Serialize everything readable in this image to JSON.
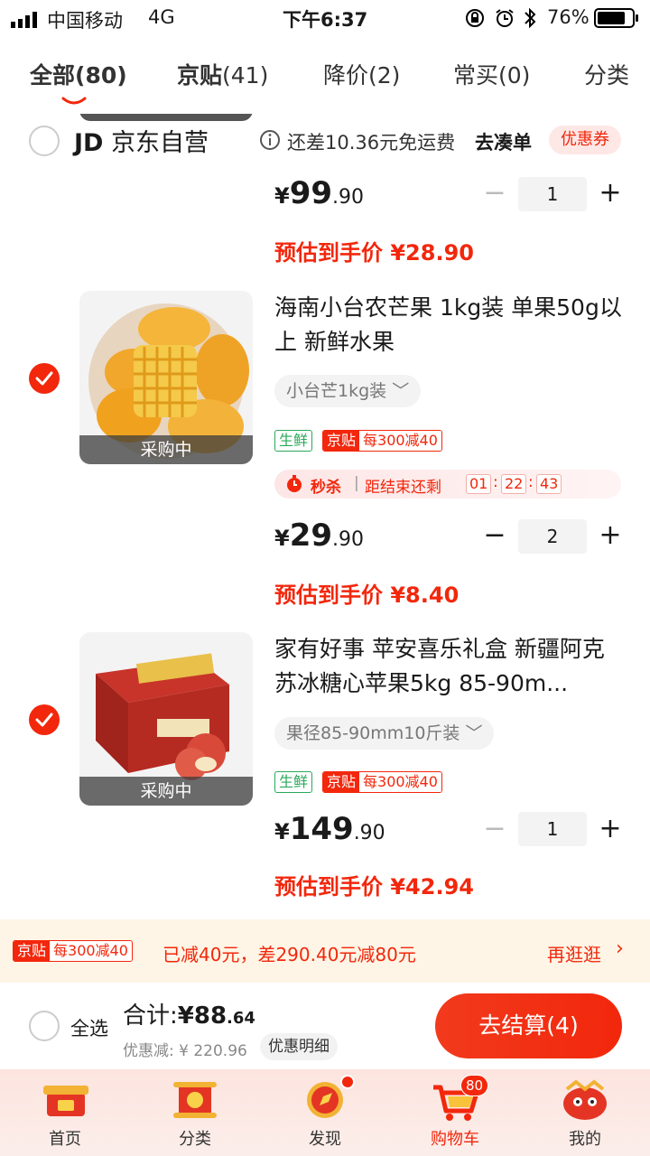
{
  "status_bar": {
    "carrier": "中国移动",
    "network": "4G",
    "time": "下午6:37",
    "battery": "76%"
  },
  "tabs": [
    {
      "name": "全部",
      "count": "(80)"
    },
    {
      "name": "京贴",
      "count": "(41)"
    },
    {
      "name": "降价",
      "count": "(2)"
    },
    {
      "name": "常买",
      "count": "(0)"
    },
    {
      "name": "分类",
      "count": ""
    }
  ],
  "store": {
    "logo": "JD",
    "name": "京东自营",
    "shipping_note": "还差10.36元免运费",
    "add_link": "去凑单",
    "coupon": "优惠券"
  },
  "items": [
    {
      "price_int": "99",
      "price_dec": ".90",
      "qty": "1",
      "est_label": "预估到手价",
      "est_price": "¥28.90"
    },
    {
      "checked": true,
      "thumb_status": "采购中",
      "title": "海南小台农芒果 1kg装 单果50g以上 新鲜水果",
      "spec": "小台芒1kg装",
      "badge_fresh": "生鲜",
      "jt_a": "京贴",
      "jt_b": "每300减40",
      "flash_label": "秒杀",
      "flash_text": "距结束还剩",
      "cd_h": "01",
      "cd_m": "22",
      "cd_s": "43",
      "price_int": "29",
      "price_dec": ".90",
      "qty": "2",
      "est_label": "预估到手价",
      "est_price": "¥8.40"
    },
    {
      "checked": true,
      "thumb_status": "采购中",
      "title": "家有好事 苹安喜乐礼盒 新疆阿克苏冰糖心苹果5kg 85-90m...",
      "spec": "果径85-90mm10斤装",
      "badge_fresh": "生鲜",
      "jt_a": "京贴",
      "jt_b": "每300减40",
      "price_int": "149",
      "price_dec": ".90",
      "qty": "1",
      "est_label": "预估到手价",
      "est_price": "¥42.94"
    }
  ],
  "currency": "¥",
  "promo": {
    "jt_a": "京贴",
    "jt_b": "每300减40",
    "text": "已减40元，差290.40元减80元",
    "link": "再逛逛"
  },
  "checkout": {
    "select_all": "全选",
    "total_label": "合计:",
    "total_int": "¥88",
    "total_dec": ".64",
    "discount": "优惠减: ¥ 220.96",
    "discount_detail": "优惠明细",
    "button": "去结算(4)"
  },
  "nav": [
    {
      "label": "首页"
    },
    {
      "label": "分类"
    },
    {
      "label": "发现"
    },
    {
      "label": "购物车",
      "badge": "80"
    },
    {
      "label": "我的"
    }
  ],
  "colors": {
    "accent": "#f2270c",
    "fresh": "#2aa95a",
    "promo_bg": "#fef5e6"
  }
}
